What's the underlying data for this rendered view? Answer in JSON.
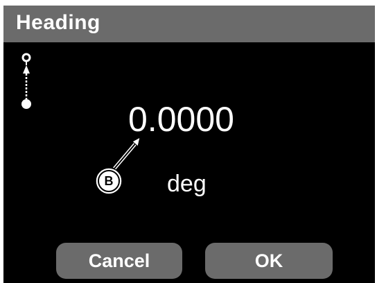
{
  "dialog": {
    "title": "Heading"
  },
  "reading": {
    "value": "0.0000",
    "unit": "deg"
  },
  "annotation": {
    "callout_label": "B"
  },
  "icons": {
    "mode_icon": "point-to-point-direction-icon"
  },
  "buttons": {
    "cancel_label": "Cancel",
    "ok_label": "OK"
  },
  "colors": {
    "background": "#000000",
    "title_bar": "#6b6b6b",
    "button": "#6b6b6b",
    "text": "#ffffff"
  }
}
